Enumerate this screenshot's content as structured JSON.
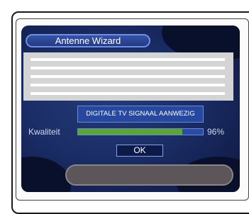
{
  "wizard": {
    "title": "Antenne Wizard",
    "status_text": "DIGITALE TV SIGNAAL AANWEZIG",
    "quality_label": "Kwaliteit",
    "quality_percent": 96,
    "quality_text": "96%",
    "ok_label": "OK"
  },
  "colors": {
    "screen_bg": "#1a2d66",
    "progress_fill": "#5aa535",
    "progress_rest": "#2a4aa6",
    "panel": "#d4d4d4",
    "button_bg": "#0c1a4a"
  }
}
